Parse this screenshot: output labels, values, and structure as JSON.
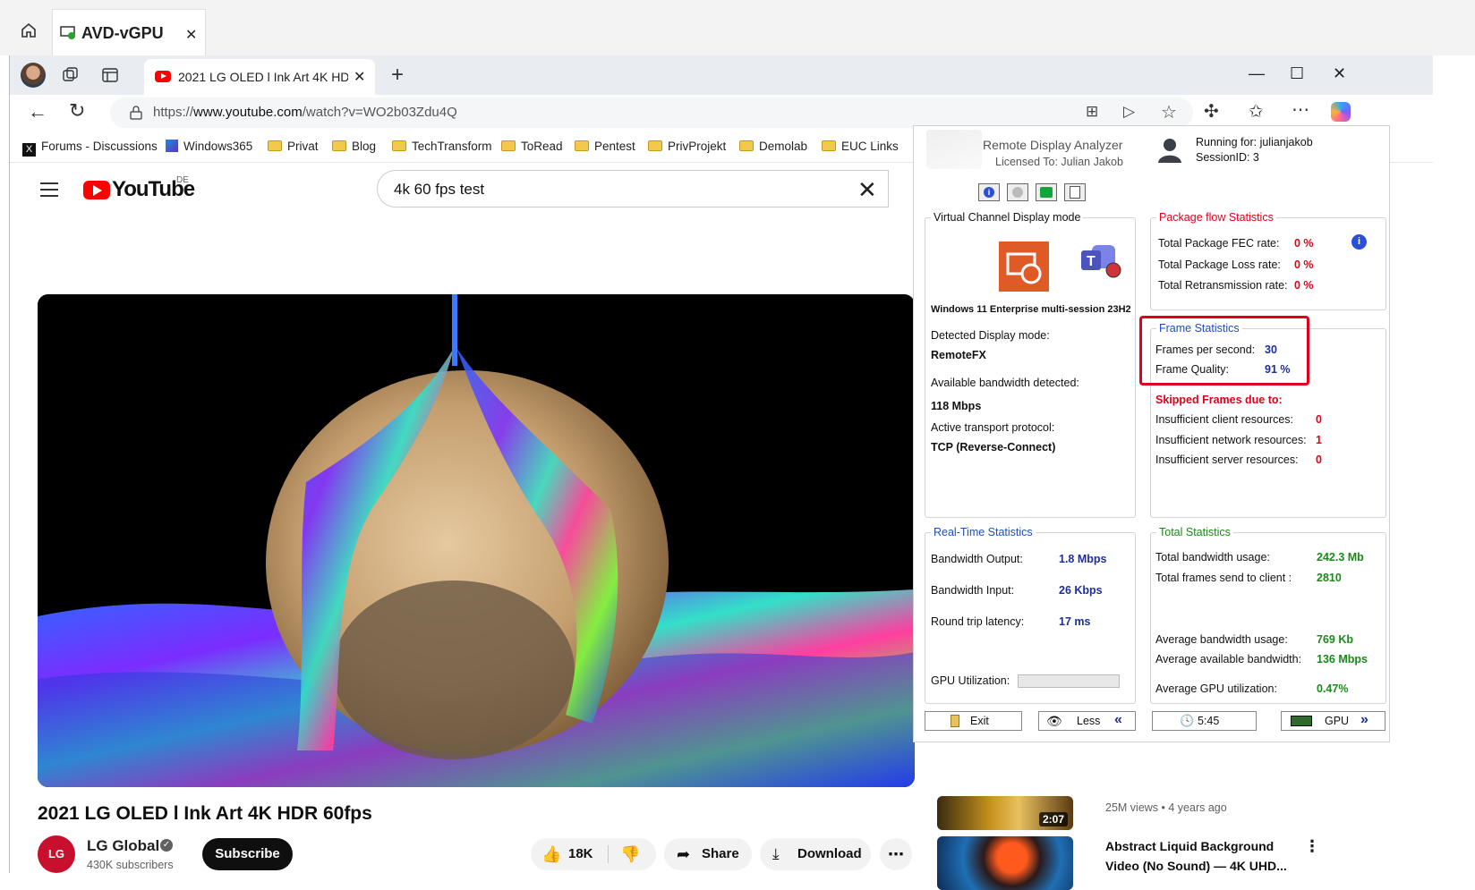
{
  "outer": {
    "tab_title": "AVD-vGPU"
  },
  "browser": {
    "tab_title": "2021 LG OLED l Ink Art 4K HDR 60fps",
    "url_prefix": "https://",
    "url_domain": "www.youtube.com",
    "url_path": "/watch?v=WO2b03Zdu4Q",
    "bookmarks": [
      "Forums - Discussions",
      "Windows365",
      "Privat",
      "Blog",
      "TechTransform",
      "ToRead",
      "Pentest",
      "PrivProjekt",
      "Demolab",
      "EUC Links"
    ]
  },
  "youtube": {
    "logo": "YouTube",
    "region": "DE",
    "search_query": "4k 60 fps test",
    "video_title": "2021 LG OLED l Ink Art 4K HDR 60fps",
    "channel_logo": "LG",
    "channel_name": "LG Global",
    "subscribers": "430K subscribers",
    "subscribe": "Subscribe",
    "likes": "18K",
    "share": "Share",
    "download": "Download",
    "sidebar": {
      "v1_duration": "2:07",
      "v1_views": "25M views",
      "v1_age": "4 years ago",
      "v2_title_1": "Abstract Liquid Background",
      "v2_title_2": "Video (No Sound) — 4K UHD..."
    }
  },
  "rda": {
    "title": "Remote Display Analyzer",
    "licensed": "Licensed To: Julian Jakob",
    "running_for": "Running for: julianjakob",
    "session": "SessionID: 3",
    "vc": {
      "caption": "Virtual Channel Display mode",
      "os": "Windows 11 Enterprise multi-session 23H2",
      "detected_label": "Detected Display mode:",
      "detected_value": "RemoteFX",
      "bw_label": "Available bandwidth detected:",
      "bw_value": "118 Mbps",
      "transport_label": "Active transport protocol:",
      "transport_value": "TCP (Reverse-Connect)"
    },
    "pkg": {
      "caption": "Package flow Statistics",
      "fec_label": "Total Package FEC rate:",
      "fec": "0 %",
      "loss_label": "Total Package Loss rate:",
      "loss": "0 %",
      "retx_label": "Total Retransmission rate:",
      "retx": "0 %"
    },
    "frame": {
      "caption": "Frame Statistics",
      "fps_label": "Frames per second:",
      "fps": "30",
      "quality_label": "Frame Quality:",
      "quality": "91 %"
    },
    "skipped": {
      "caption": "Skipped Frames due to:",
      "client_label": "Insufficient client resources:",
      "client": "0",
      "network_label": "Insufficient network resources:",
      "network": "1",
      "server_label": "Insufficient server resources:",
      "server": "0"
    },
    "rt": {
      "caption": "Real-Time Statistics",
      "out_label": "Bandwidth Output:",
      "out": "1.8 Mbps",
      "in_label": "Bandwidth Input:",
      "in": "26 Kbps",
      "rtt_label": "Round trip latency:",
      "rtt": "17 ms",
      "gpu_label": "GPU Utilization:"
    },
    "total": {
      "caption": "Total Statistics",
      "usage_label": "Total bandwidth usage:",
      "usage": "242.3 Mb",
      "frames_label": "Total frames send to client :",
      "frames": "2810",
      "avg_label": "Average bandwidth usage:",
      "avg": "769 Kb",
      "avail_label": "Average available bandwidth:",
      "avail": "136 Mbps",
      "gpu_label": "Average GPU utilization:",
      "gpu": "0.47%"
    },
    "buttons": {
      "exit": "Exit",
      "less": "Less",
      "time": "5:45",
      "gpu": "GPU"
    },
    "highlight_color": "#e0001b"
  }
}
